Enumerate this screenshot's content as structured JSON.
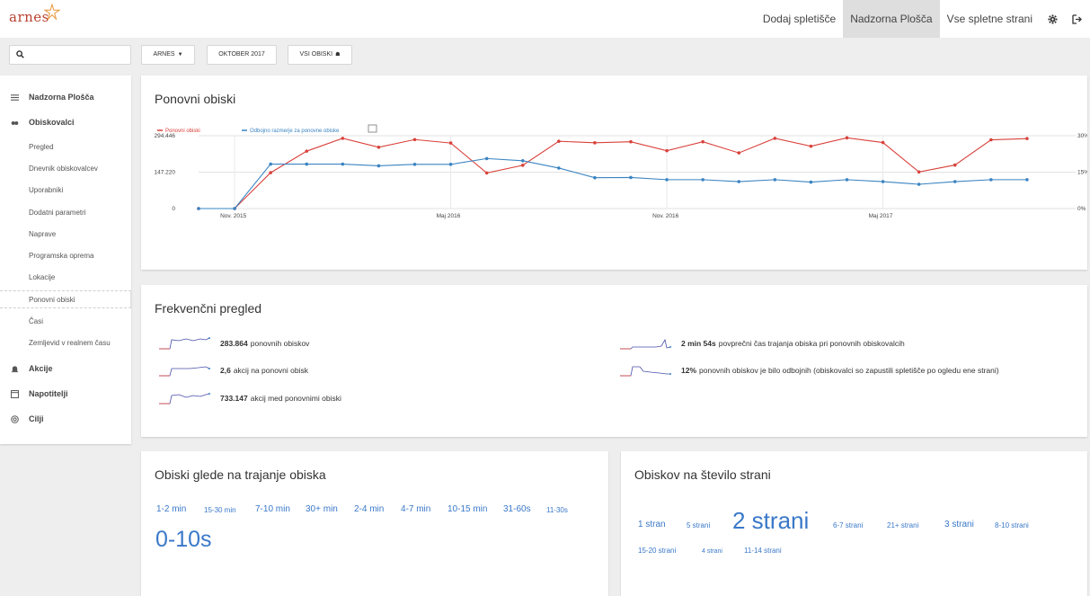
{
  "app": {
    "logo_text": "arnes"
  },
  "topnav": {
    "items": [
      {
        "label": "Dodaj spletišče",
        "active": false
      },
      {
        "label": "Nadzorna Plošča",
        "active": true
      },
      {
        "label": "Vse spletne strani",
        "active": false
      }
    ],
    "icons": [
      "gear-icon",
      "logout-icon"
    ]
  },
  "controls": {
    "search_placeholder": "",
    "site_label": "ARNES",
    "period_label": "OKTOBER 2017",
    "segment_label": "VSI OBISKI"
  },
  "sidebar": {
    "items": [
      {
        "label": "Nadzorna Plošča",
        "type": "main",
        "icon": "menu-icon"
      },
      {
        "label": "Obiskovalci",
        "type": "main",
        "icon": "eye-icon"
      },
      {
        "label": "Pregled",
        "type": "sub"
      },
      {
        "label": "Dnevnik obiskovalcev",
        "type": "sub"
      },
      {
        "label": "Uporabniki",
        "type": "sub"
      },
      {
        "label": "Dodatni parametri",
        "type": "sub"
      },
      {
        "label": "Naprave",
        "type": "sub"
      },
      {
        "label": "Programska oprema",
        "type": "sub"
      },
      {
        "label": "Lokacije",
        "type": "sub"
      },
      {
        "label": "Ponovni obiski",
        "type": "sub",
        "active": true
      },
      {
        "label": "Časi",
        "type": "sub"
      },
      {
        "label": "Zemljevid v realnem času",
        "type": "sub"
      },
      {
        "label": "Akcije",
        "type": "main",
        "icon": "bell-icon"
      },
      {
        "label": "Napotitelji",
        "type": "main",
        "icon": "window-icon"
      },
      {
        "label": "Cilji",
        "type": "main",
        "icon": "target-icon"
      }
    ]
  },
  "returning_card": {
    "title": "Ponovni obiski"
  },
  "chart_data": {
    "type": "line",
    "title": "",
    "legend_position": "top-left",
    "x_ticks": [
      "Nov. 2015",
      "Maj 2016",
      "Nov. 2016",
      "Maj 2017"
    ],
    "y_left_ticks": [
      "294.446",
      "147.220",
      "0"
    ],
    "y_right_ticks": [
      "30%",
      "15%",
      "0%"
    ],
    "ylim_left": [
      0,
      294446
    ],
    "ylim_right": [
      0,
      30
    ],
    "grid": true,
    "x": [
      "2015-10",
      "2015-11",
      "2015-12",
      "2016-01",
      "2016-02",
      "2016-03",
      "2016-04",
      "2016-05",
      "2016-06",
      "2016-07",
      "2016-08",
      "2016-09",
      "2016-10",
      "2016-11",
      "2016-12",
      "2017-01",
      "2017-02",
      "2017-03",
      "2017-04",
      "2017-05",
      "2017-06",
      "2017-07",
      "2017-08",
      "2017-09",
      "2017-10"
    ],
    "series": [
      {
        "name": "Ponovni obiski",
        "color": "#d9413b",
        "axis": "left",
        "values": [
          0,
          0,
          145000,
          232000,
          284000,
          248000,
          279000,
          265000,
          144000,
          175000,
          272000,
          266000,
          270000,
          234000,
          270000,
          225000,
          284000,
          252000,
          286000,
          267000,
          148000,
          176000,
          278000,
          283000,
          0
        ]
      },
      {
        "name": "Odbojno razmerje za ponovne obiske",
        "color": "#3a84c2",
        "axis": "right",
        "values": [
          0,
          0,
          18.3,
          18.3,
          18.3,
          17.6,
          18.2,
          18.2,
          20.6,
          19.7,
          16.7,
          12.7,
          12.8,
          11.9,
          11.9,
          11.1,
          11.9,
          10.9,
          11.9,
          11.1,
          10.0,
          11.1,
          11.9,
          11.9,
          0
        ]
      }
    ]
  },
  "freq_card": {
    "title": "Frekvenčni pregled",
    "rows": [
      {
        "value": "283.864",
        "text": "ponovnih obiskov"
      },
      {
        "value": "2,6",
        "text": "akcij na ponovni obisk"
      },
      {
        "value": "733.147",
        "text": "akcij med ponovnimi obiski"
      },
      {
        "value": "2 min 54s",
        "text": "povprečni čas trajanja obiska pri ponovnih obiskovalcih"
      },
      {
        "value": "12%",
        "text": "ponovnih obiskov je bilo odbojnih (obiskovalci so zapustili spletišče po ogledu ene strani)"
      }
    ]
  },
  "duration_card": {
    "title": "Obiski glede na trajanje obiska",
    "tags": [
      "1-2 min",
      "15-30 min",
      "7-10 min",
      "30+ min",
      "2-4 min",
      "4-7 min",
      "10-15 min",
      "31-60s",
      "11-30s",
      "0-10s"
    ]
  },
  "pages_card": {
    "title": "Obiskov na število strani",
    "tags": [
      "1 stran",
      "5 strani",
      "2 strani",
      "6-7 strani",
      "21+ strani",
      "3 strani",
      "8-10 strani",
      "15-20 strani",
      "4 strani",
      "11-14 strani"
    ]
  },
  "colors": {
    "accent_blue": "#3a78c8",
    "series_red": "#d9413b",
    "series_blue": "#3a84c2",
    "logo_red": "#b8402f"
  }
}
